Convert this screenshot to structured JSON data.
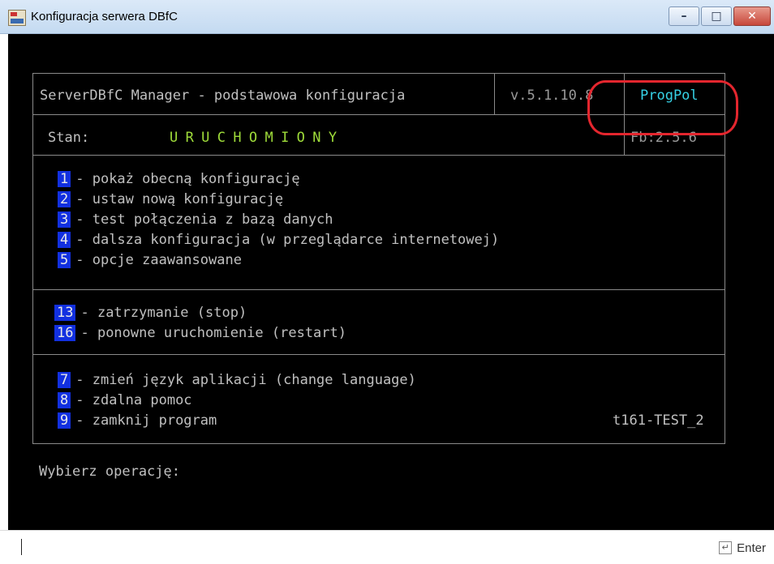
{
  "window": {
    "title": "Konfiguracja serwera DBfC",
    "minimize_glyph": "–",
    "maximize_glyph": "□",
    "close_glyph": "✕",
    "icon": "database-app-icon"
  },
  "header": {
    "app_name": "ServerDBfC Manager - podstawowa konfiguracja",
    "version": "v.5.1.10.8",
    "vendor": "ProgPol"
  },
  "status": {
    "label": "Stan:",
    "value": "URUCHOMIONY",
    "firebird_version": "Fb:2.5.6"
  },
  "menu_main": [
    {
      "num": "1",
      "label": "- pokaż obecną konfigurację"
    },
    {
      "num": "2",
      "label": "- ustaw nową konfigurację"
    },
    {
      "num": "3",
      "label": "- test połączenia z bazą danych"
    },
    {
      "num": "4",
      "label": "- dalsza konfiguracja (w przeglądarce internetowej)"
    },
    {
      "num": "5",
      "label": "- opcje zaawansowane"
    }
  ],
  "menu_service": [
    {
      "num": "13",
      "label": "- zatrzymanie (stop)"
    },
    {
      "num": "16",
      "label": "- ponowne uruchomienie (restart)"
    }
  ],
  "menu_other": [
    {
      "num": "7",
      "label": "- zmień język aplikacji (change language)"
    },
    {
      "num": "8",
      "label": "- zdalna pomoc"
    },
    {
      "num": "9",
      "label": "- zamknij program"
    }
  ],
  "machine_id": "t161-TEST_2",
  "prompt": "Wybierz operację:",
  "input": {
    "value": "",
    "enter_label": "Enter",
    "enter_glyph": "↵"
  },
  "colors": {
    "console_bg": "#000000",
    "accent": "#36d2e6",
    "status_running": "#9fdc3a",
    "number_badge": "#1230e0",
    "annotation": "#e4262e"
  }
}
